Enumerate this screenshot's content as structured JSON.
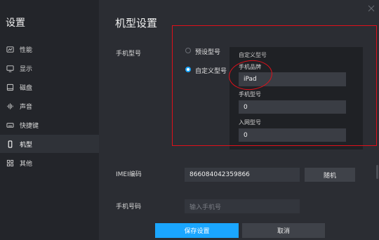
{
  "sidebar": {
    "title": "设置",
    "items": [
      {
        "label": "性能",
        "icon": "performance-icon"
      },
      {
        "label": "显示",
        "icon": "monitor-icon"
      },
      {
        "label": "磁盘",
        "icon": "disk-icon"
      },
      {
        "label": "声音",
        "icon": "sound-icon"
      },
      {
        "label": "快捷键",
        "icon": "keyboard-icon"
      },
      {
        "label": "机型",
        "icon": "phone-icon",
        "active": true
      },
      {
        "label": "其他",
        "icon": "grid-icon"
      }
    ]
  },
  "main": {
    "title": "机型设置",
    "phone_model_label": "手机型号",
    "preset_label": "预设型号",
    "custom_label": "自定义型号",
    "custom_panel": {
      "title": "自定义型号",
      "brand_label": "手机品牌",
      "brand_value": "iPad",
      "model_label": "手机型号",
      "model_value": "0",
      "network_label": "入网型号",
      "network_value": "0"
    },
    "imei_label": "IMEI编码",
    "imei_value": "866084042359866",
    "random_button": "随机",
    "phone_number_label": "手机号码",
    "phone_number_placeholder": "输入手机号",
    "save_button": "保存设置",
    "cancel_button": "取消"
  },
  "colors": {
    "accent": "#1aa6ff",
    "annotation": "#e0101a"
  }
}
